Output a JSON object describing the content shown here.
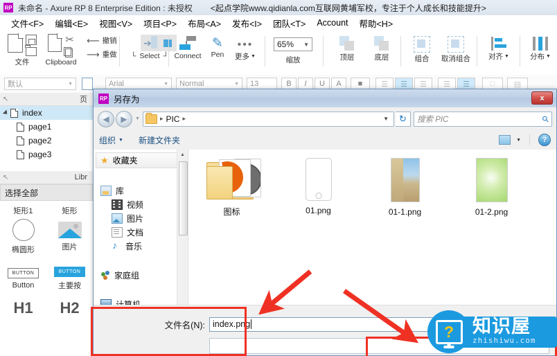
{
  "app": {
    "rp_badge": "RP",
    "title": "未命名 - Axure RP 8 Enterprise Edition : 未授权",
    "promo": "<起点学院www.qidianla.com互联网黄埔军校，专注于个人成长和技能提升>",
    "menu": [
      "文件<F>",
      "编辑<E>",
      "视图<V>",
      "项目<P>",
      "布局<A>",
      "发布<I>",
      "团队<T>",
      "Account",
      "帮助<H>"
    ]
  },
  "ribbon": {
    "groups": [
      {
        "label": "文件",
        "icons": [
          "new-document-icon",
          "save-icon",
          "open-folder-icon"
        ]
      },
      {
        "label": "Clipboard",
        "icons": [
          "paste-icon",
          "cut-icon",
          "copy-icon"
        ]
      },
      {
        "label": "",
        "undo": "撤销",
        "redo": "重做"
      },
      {
        "label": "Select",
        "left_bracket": "⌐",
        "right_bracket": "¬"
      },
      {
        "label": "Connect"
      },
      {
        "label": "Pen"
      },
      {
        "label": "更多"
      },
      {
        "label": "缩放",
        "zoom_value": "65%"
      },
      {
        "label": "顶层"
      },
      {
        "label": "底层"
      },
      {
        "label": "组合"
      },
      {
        "label": "取消组合"
      },
      {
        "label": "对齐"
      },
      {
        "label": "分布"
      }
    ],
    "zoom_value": "65%",
    "zoom_label": "缩放",
    "undo_label": "撤销",
    "redo_label": "重做",
    "select_label": "Select",
    "connect_label": "Connect",
    "pen_label": "Pen",
    "more_label": "更多",
    "file_label": "文件",
    "clipboard_label": "Clipboard",
    "top_label": "顶层",
    "bottom_label": "底层",
    "group_label": "组合",
    "ungroup_label": "取消组合",
    "align_label": "对齐",
    "distribute_label": "分布"
  },
  "formatbar": {
    "style": "默认",
    "font": "Arial",
    "weight": "Normal",
    "size": "13"
  },
  "left_panel": {
    "pages_header": "页",
    "tree": [
      {
        "label": "index",
        "selected": true,
        "indent": 0
      },
      {
        "label": "page1",
        "selected": false,
        "indent": 1
      },
      {
        "label": "page2",
        "selected": false,
        "indent": 1
      },
      {
        "label": "page3",
        "selected": false,
        "indent": 1
      }
    ],
    "library_header": "Libr",
    "library_select": "选择全部",
    "widgets": [
      {
        "label": "矩形1",
        "kind": "rect"
      },
      {
        "label": "矩形",
        "kind": "rect"
      },
      {
        "label": "椭圆形",
        "kind": "ellipse"
      },
      {
        "label": "图片",
        "kind": "image"
      },
      {
        "label": "Button",
        "kind": "button"
      },
      {
        "label": "主要按",
        "kind": "button-primary"
      },
      {
        "label": "H1",
        "kind": "heading"
      },
      {
        "label": "H2",
        "kind": "heading"
      }
    ],
    "button_glyph": "BUTTON",
    "h1_glyph": "H1",
    "h2_glyph": "H2"
  },
  "dialog": {
    "rp_badge": "RP",
    "title": "另存为",
    "close_label": "x",
    "back_glyph": "◀",
    "forward_glyph": "▶",
    "address": {
      "crumbs": [
        "PIC"
      ],
      "separator": "▸"
    },
    "search_placeholder": "搜索 PIC",
    "commands": {
      "organize": "组织",
      "new_folder": "新建文件夹",
      "help": "?"
    },
    "nav_pane": {
      "favorites": "收藏夹",
      "items": [
        {
          "label": "库",
          "icon": "library-icon",
          "level": 0
        },
        {
          "label": "视频",
          "icon": "video-icon",
          "level": 1
        },
        {
          "label": "图片",
          "icon": "pictures-icon",
          "level": 1
        },
        {
          "label": "文档",
          "icon": "documents-icon",
          "level": 1
        },
        {
          "label": "音乐",
          "icon": "music-icon",
          "level": 1
        },
        {
          "label": "家庭组",
          "icon": "homegroup-icon",
          "level": 0
        },
        {
          "label": "计算机",
          "icon": "computer-icon",
          "level": 0
        }
      ]
    },
    "files": [
      {
        "name": "图标",
        "kind": "folder"
      },
      {
        "name": "01.png",
        "kind": "phone-image"
      },
      {
        "name": "01-1.png",
        "kind": "landscape-image"
      },
      {
        "name": "01-2.png",
        "kind": "green-image"
      }
    ],
    "filename_label": "文件名(N):",
    "filename_value": "index.png"
  },
  "watermark": {
    "cn": "知识屋",
    "en": "zhishiwu.com",
    "question_mark": "?"
  }
}
